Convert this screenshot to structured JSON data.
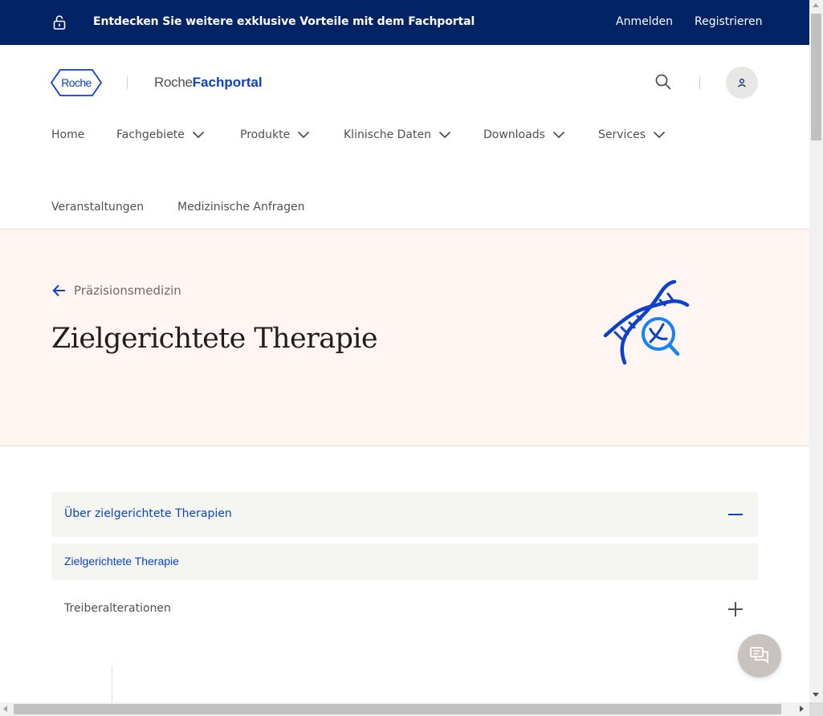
{
  "topbar": {
    "promo": "Entdecken Sie weitere exklusive Vorteile mit dem Fachportal",
    "login": "Anmelden",
    "register": "Registrieren",
    "lock_icon": "lock-open-icon"
  },
  "header": {
    "logo_text": "Roche",
    "brand_prefix": "Roche",
    "brand_suffix": "Fachportal",
    "search_icon": "search-icon",
    "user_icon": "user-icon"
  },
  "nav": {
    "row1": [
      {
        "label": "Home",
        "dropdown": false
      },
      {
        "label": "Fachgebiete",
        "dropdown": true
      },
      {
        "label": "Produkte",
        "dropdown": true
      },
      {
        "label": "Klinische Daten",
        "dropdown": true
      },
      {
        "label": "Downloads",
        "dropdown": true
      },
      {
        "label": "Services",
        "dropdown": true
      }
    ],
    "row2": [
      {
        "label": "Veranstaltungen"
      },
      {
        "label": "Medizinische Anfragen"
      }
    ]
  },
  "hero": {
    "back_label": "Präzisionsmedizin",
    "title": "Zielgerichtete Therapie",
    "illustration": "dna-magnifier-icon"
  },
  "accordion": {
    "section_title": "Über zielgerichtete Therapien",
    "active_item": "Zielgerichtete Therapie",
    "next_item": "Treiberalterationen"
  },
  "chat": {
    "icon": "chat-icon"
  },
  "colors": {
    "navy": "#022366",
    "accent_blue": "#0b41cd",
    "hero_bg": "#fff5f3",
    "panel_bg": "#f5f5f2",
    "text": "#544f4f"
  }
}
